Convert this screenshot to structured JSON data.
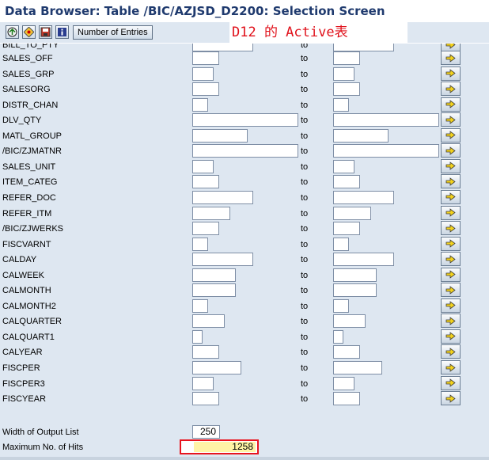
{
  "window": {
    "title": "Data Browser: Table /BIC/AZJSD_D2200: Selection Screen"
  },
  "toolbar": {
    "buttons": [
      {
        "icon": "execute-icon"
      },
      {
        "icon": "get-variant-icon"
      },
      {
        "icon": "save-variant-icon"
      },
      {
        "icon": "info-icon"
      }
    ],
    "number_of_entries_label": "Number of Entries"
  },
  "overlay_text": "D12 的 Active表",
  "selection_fields": [
    {
      "label": "BILL_TO_PTY",
      "to_label": "to"
    },
    {
      "label": "SALES_OFF",
      "to_label": "to"
    },
    {
      "label": "SALES_GRP",
      "to_label": "to"
    },
    {
      "label": "SALESORG",
      "to_label": "to"
    },
    {
      "label": "DISTR_CHAN",
      "to_label": "to"
    },
    {
      "label": "DLV_QTY",
      "to_label": "to"
    },
    {
      "label": "MATL_GROUP",
      "to_label": "to"
    },
    {
      "label": "/BIC/ZJMATNR",
      "to_label": "to"
    },
    {
      "label": "SALES_UNIT",
      "to_label": "to"
    },
    {
      "label": "ITEM_CATEG",
      "to_label": "to"
    },
    {
      "label": "REFER_DOC",
      "to_label": "to"
    },
    {
      "label": "REFER_ITM",
      "to_label": "to"
    },
    {
      "label": "/BIC/ZJWERKS",
      "to_label": "to"
    },
    {
      "label": "FISCVARNT",
      "to_label": "to"
    },
    {
      "label": "CALDAY",
      "to_label": "to"
    },
    {
      "label": "CALWEEK",
      "to_label": "to"
    },
    {
      "label": "CALMONTH",
      "to_label": "to"
    },
    {
      "label": "CALMONTH2",
      "to_label": "to"
    },
    {
      "label": "CALQUARTER",
      "to_label": "to"
    },
    {
      "label": "CALQUART1",
      "to_label": "to"
    },
    {
      "label": "CALYEAR",
      "to_label": "to"
    },
    {
      "label": "FISCPER",
      "to_label": "to"
    },
    {
      "label": "FISCPER3",
      "to_label": "to"
    },
    {
      "label": "FISCYEAR",
      "to_label": "to"
    }
  ],
  "output": {
    "width_label": "Width of Output List",
    "width_value": "250",
    "max_hits_label": "Maximum No. of Hits",
    "max_hits_value": "1258"
  },
  "colors": {
    "title": "#1f3a6e",
    "form_background": "#dee7f1",
    "overlay_text": "#e0101a",
    "highlight_border": "#e8141f",
    "highlight_fill": "#fff4a6"
  }
}
